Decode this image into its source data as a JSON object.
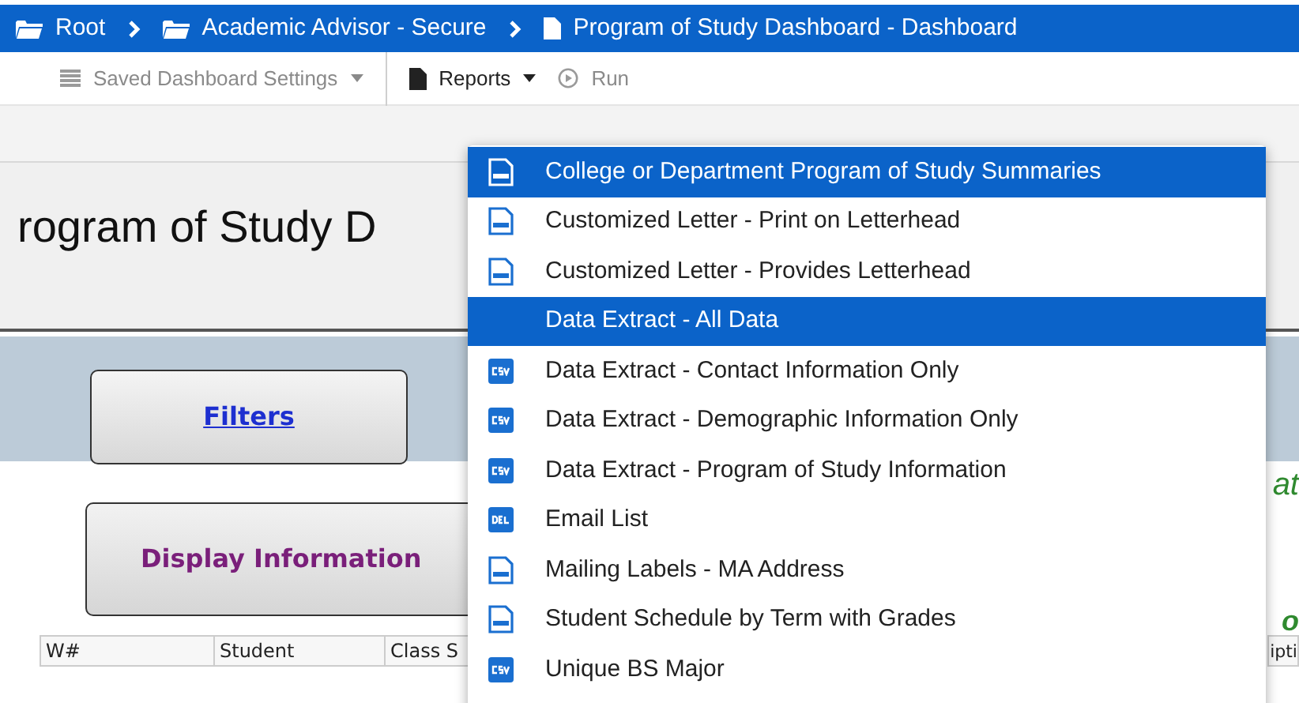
{
  "breadcrumb": [
    {
      "label": "Root",
      "kind": "folder"
    },
    {
      "label": "Academic Advisor - Secure",
      "kind": "folder"
    },
    {
      "label": "Program of Study Dashboard - Dashboard",
      "kind": "document"
    }
  ],
  "toolbar": [
    {
      "label": "Saved Dashboard Settings",
      "kind": "list",
      "disabled": true,
      "dropdown": true
    },
    {
      "label": "Reports",
      "kind": "document",
      "disabled": false,
      "dropdown": true
    },
    {
      "label": "Run",
      "kind": "play",
      "disabled": true,
      "dropdown": false
    }
  ],
  "page_title": "rogram of Study D",
  "filters_button": "Filters",
  "display_button": "Display Information",
  "side_texts": [
    "at",
    "o"
  ],
  "table": {
    "columns": [
      "W#",
      "Student",
      "Class S"
    ],
    "column_partial": "ipti"
  },
  "menu": [
    {
      "label": "College or Department Program of Study Summaries",
      "kind": "doc",
      "selected": true
    },
    {
      "label": "Customized Letter - Print on Letterhead",
      "kind": "doc",
      "selected": false
    },
    {
      "label": "Customized Letter - Provides Letterhead",
      "kind": "doc",
      "selected": false
    },
    {
      "label": "Data Extract - All Data",
      "kind": "none",
      "selected": true
    },
    {
      "label": "Data Extract - Contact Information Only",
      "kind": "csv",
      "selected": false
    },
    {
      "label": "Data Extract - Demographic Information Only",
      "kind": "csv",
      "selected": false
    },
    {
      "label": "Data Extract - Program of Study Information",
      "kind": "csv",
      "selected": false
    },
    {
      "label": "Email List",
      "kind": "del",
      "selected": false
    },
    {
      "label": "Mailing Labels - MA Address",
      "kind": "doc",
      "selected": false
    },
    {
      "label": "Student Schedule by Term with Grades",
      "kind": "doc",
      "selected": false
    },
    {
      "label": "Unique BS Major",
      "kind": "csv",
      "selected": false
    }
  ]
}
